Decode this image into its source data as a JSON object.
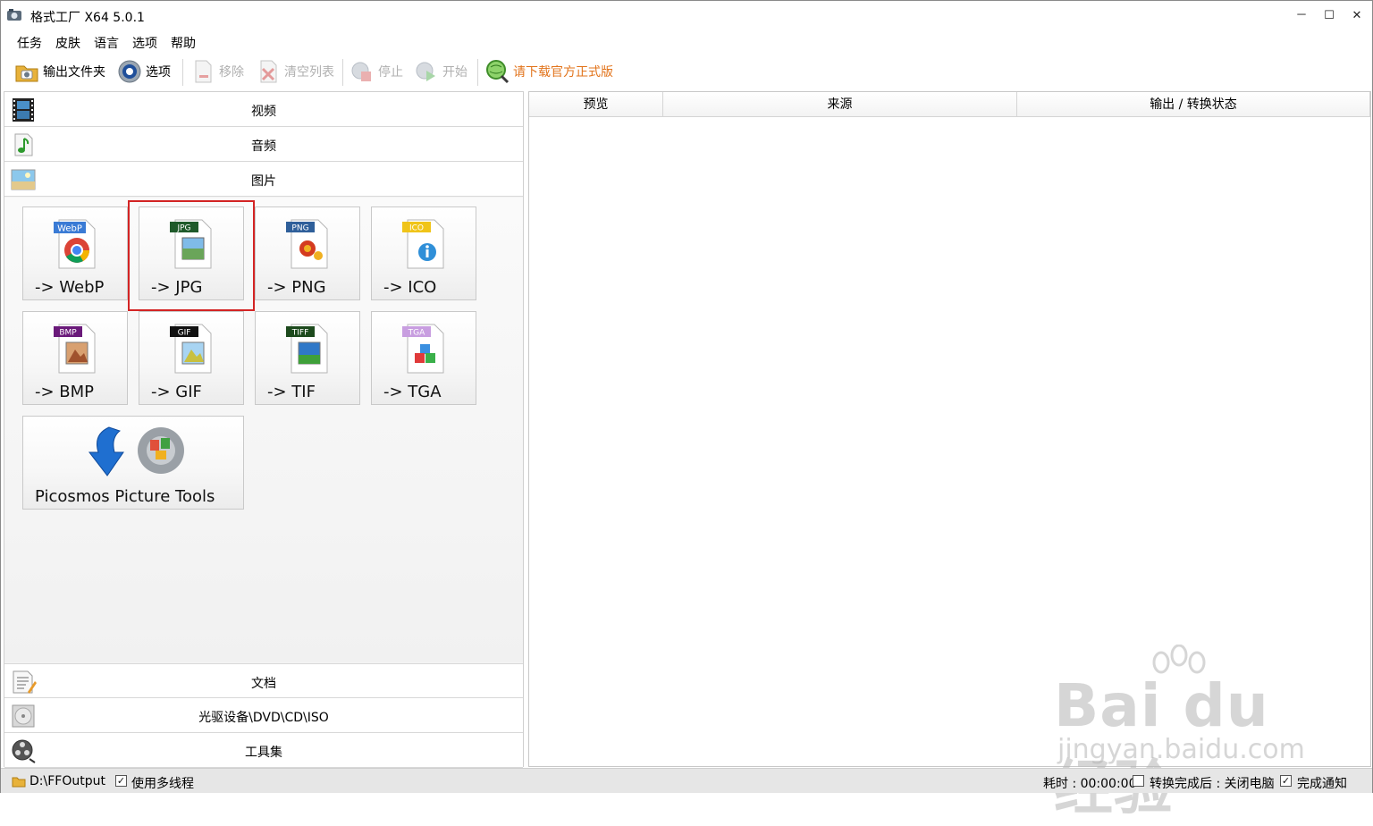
{
  "window": {
    "title": "格式工厂 X64 5.0.1"
  },
  "title_buttons": {
    "minimize": "－",
    "maximize": "☐",
    "close": "✕"
  },
  "menu": [
    "任务",
    "皮肤",
    "语言",
    "选项",
    "帮助"
  ],
  "toolbar": {
    "output_folder": "输出文件夹",
    "options": "选项",
    "remove": "移除",
    "clear_list": "清空列表",
    "stop": "停止",
    "start": "开始",
    "download_official": "请下载官方正式版"
  },
  "categories_top": [
    "视频",
    "音频",
    "图片"
  ],
  "categories_bottom": [
    "文档",
    "光驱设备\\DVD\\CD\\ISO",
    "工具集"
  ],
  "tiles": [
    {
      "label": "-> WebP",
      "badge": "WebP",
      "badge_color": "#3a7bd5"
    },
    {
      "label": "-> JPG",
      "badge": "JPG",
      "badge_color": "#1f5a2a"
    },
    {
      "label": "-> PNG",
      "badge": "PNG",
      "badge_color": "#2f5f9a"
    },
    {
      "label": "-> ICO",
      "badge": "ICO",
      "badge_color": "#f0c419"
    },
    {
      "label": "-> BMP",
      "badge": "BMP",
      "badge_color": "#6a1a7a"
    },
    {
      "label": "-> GIF",
      "badge": "GIF",
      "badge_color": "#111111"
    },
    {
      "label": "-> TIF",
      "badge": "TIFF",
      "badge_color": "#1d4a1d"
    },
    {
      "label": "-> TGA",
      "badge": "TGA",
      "badge_color": "#c89ee0"
    }
  ],
  "tool_tile": {
    "label": "Picosmos Picture Tools"
  },
  "columns": [
    "预览",
    "来源",
    "输出 / 转换状态"
  ],
  "status": {
    "output_path": "D:\\FFOutput",
    "multithread": "使用多线程",
    "multithread_checked": true,
    "elapsed": "耗时 : 00:00:00",
    "after_convert": "转换完成后 : 关闭电脑",
    "after_convert_checked": false,
    "notify": "完成通知",
    "notify_checked": true
  },
  "watermark": {
    "brand": "Bai du 经验",
    "url": "jingyan.baidu.com"
  }
}
